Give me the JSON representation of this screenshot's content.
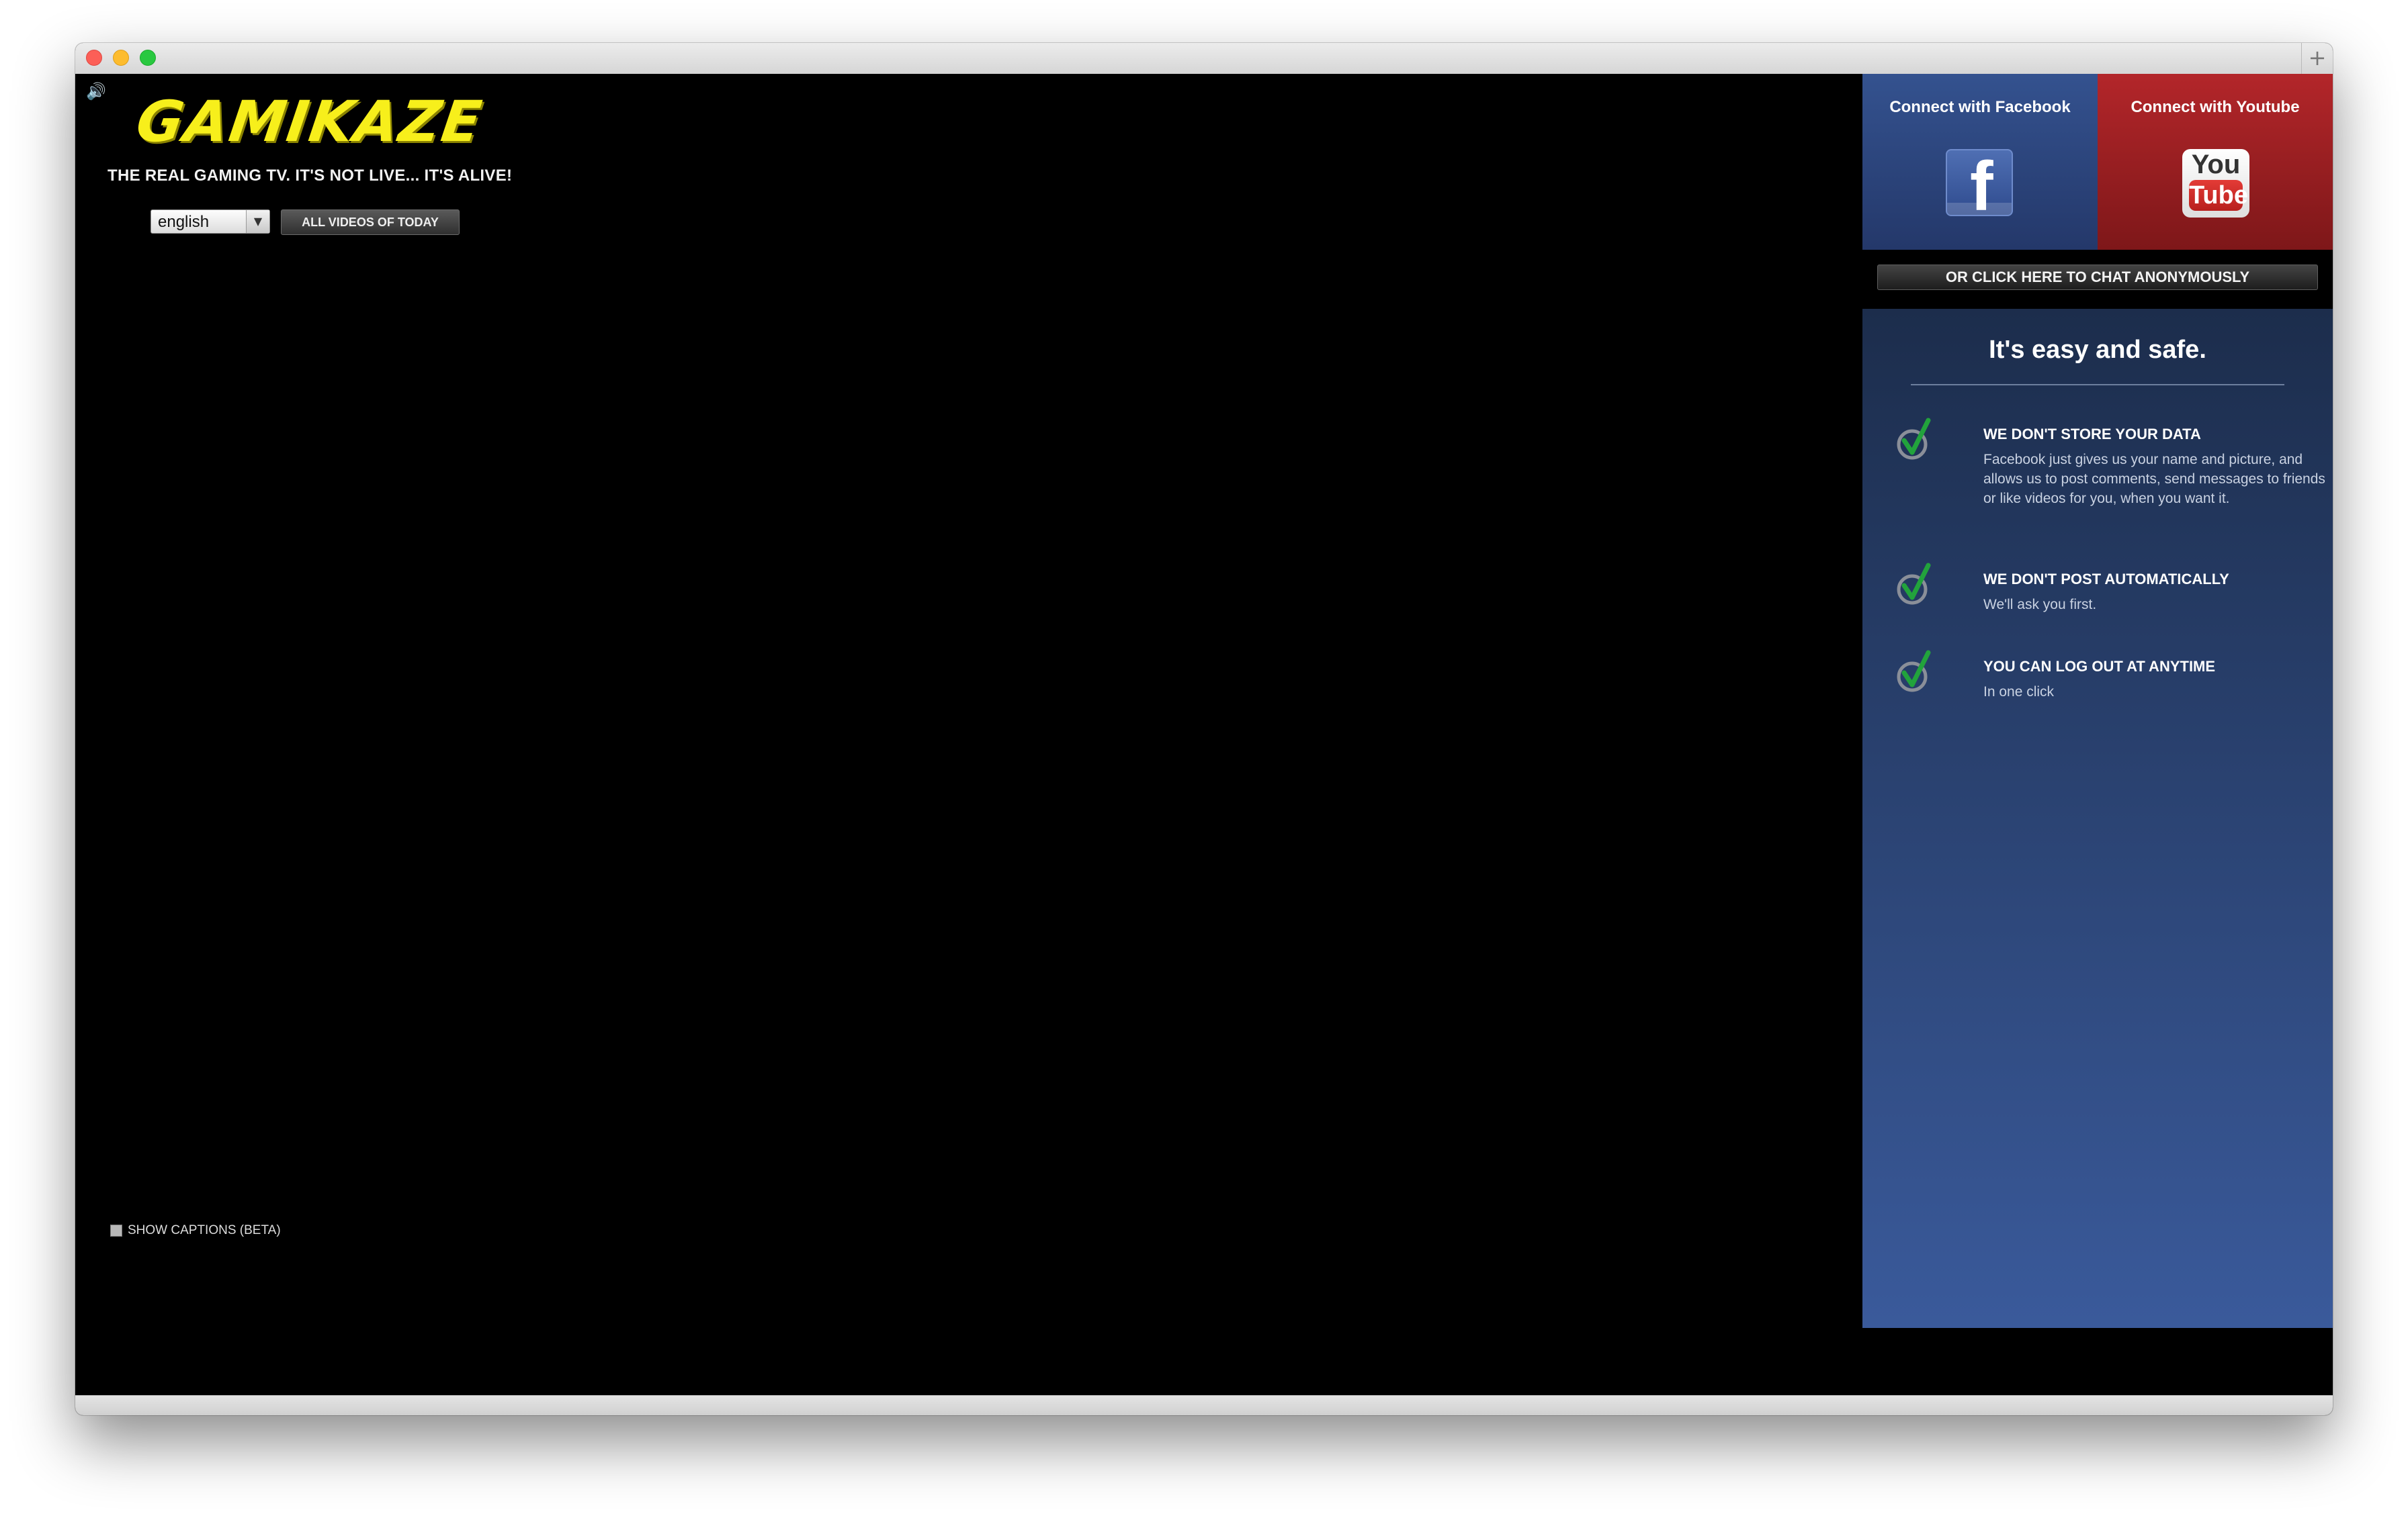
{
  "window": {
    "new_tab_glyph": "+"
  },
  "header": {
    "speaker_icon": "speaker-icon",
    "logo_text": "GAMIKAZE",
    "tagline": "THE REAL GAMING TV. IT'S NOT LIVE... IT'S ALIVE!",
    "language": {
      "selected": "english"
    },
    "all_videos_label": "ALL VIDEOS OF TODAY"
  },
  "player": {
    "captions_label": "SHOW CAPTIONS (BETA)",
    "captions_checked": false
  },
  "connect": {
    "facebook": {
      "label": "Connect with Facebook",
      "color": "#2b4279"
    },
    "youtube": {
      "label": "Connect with Youtube",
      "logo_top": "You",
      "logo_bottom": "Tube",
      "color": "#a02023"
    },
    "anonymous_label": "OR CLICK HERE TO CHAT ANONYMOUSLY"
  },
  "info": {
    "title": "It's easy and safe.",
    "features": [
      {
        "title": "WE DON'T STORE YOUR DATA",
        "description": "Facebook just gives us your name and picture, and allows us to post comments, send messages to friends or like videos for you, when you want it."
      },
      {
        "title": "WE DON'T POST AUTOMATICALLY",
        "description": "We'll ask you first."
      },
      {
        "title": "YOU CAN LOG OUT AT ANYTIME",
        "description": "In one click"
      }
    ]
  }
}
